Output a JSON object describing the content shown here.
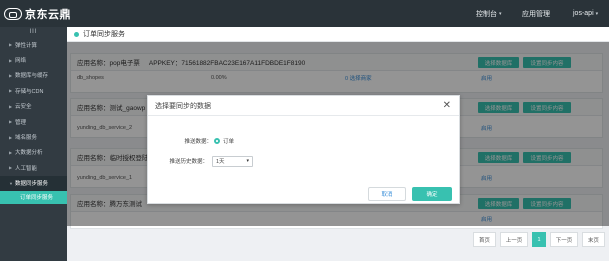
{
  "header": {
    "logo_text": "京东云鼎",
    "console": "控制台",
    "app_management": "应用管理",
    "user": "jos-api",
    "caret": "▾"
  },
  "sidebar": {
    "toggle": "III",
    "items": [
      {
        "label": "弹性计算"
      },
      {
        "label": "网络"
      },
      {
        "label": "数据库与缓存"
      },
      {
        "label": "存储与CDN"
      },
      {
        "label": "云安全"
      },
      {
        "label": "管理"
      },
      {
        "label": "域名服务"
      },
      {
        "label": "大数据分析"
      },
      {
        "label": "人工智能"
      },
      {
        "label": "数据同步服务"
      }
    ],
    "sub_item": "订单同步服务"
  },
  "page": {
    "title": "订单同步服务"
  },
  "cards": [
    {
      "app_name": "应用名称：pop电子票",
      "appkey": "APPKEY：71561882FBAC23E167A11FDBDE1F8190",
      "db": "db_shopes",
      "progress": "0.00%",
      "selected": "0 选择商家",
      "action": "启用",
      "btn_db": "选择数据库",
      "btn_sync": "设置同步内容"
    },
    {
      "app_name": "应用名称：测试_gaowp",
      "appkey": "",
      "db": "yunding_db_service_2",
      "progress": "",
      "selected": "",
      "action": "启用",
      "btn_db": "选择数据库",
      "btn_sync": "设置同步内容"
    },
    {
      "app_name": "应用名称：临时授权登陆",
      "appkey": "",
      "db": "yunding_db_service_1",
      "progress": "",
      "selected": "",
      "action": "启用",
      "btn_db": "选择数据库",
      "btn_sync": "设置同步内容"
    },
    {
      "app_name": "应用名称：腾万东测试",
      "appkey": "",
      "db": "",
      "progress": "",
      "selected": "",
      "action": "启用",
      "btn_db": "选择数据库",
      "btn_sync": "设置同步内容"
    }
  ],
  "modal": {
    "title": "选择要同步的数据",
    "close": "✕",
    "push_label": "推送数据：",
    "push_option": "订单",
    "history_label": "推送历史数据：",
    "history_value": "1天",
    "chev": "▾",
    "cancel": "取消",
    "ok": "确定"
  },
  "pager": {
    "first": "首页",
    "prev": "上一页",
    "current": "1",
    "next": "下一页",
    "last": "末页"
  }
}
